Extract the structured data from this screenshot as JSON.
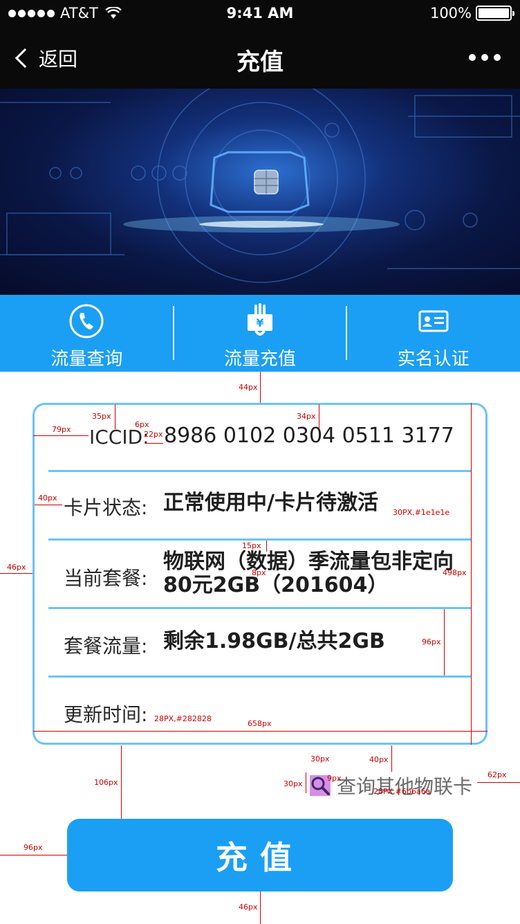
{
  "status_bar": {
    "carrier": "AT&T",
    "time": "9:41 AM",
    "battery": "100%"
  },
  "nav": {
    "back_label": "返回",
    "title": "充值"
  },
  "actions": [
    {
      "label": "流量查询",
      "icon": "phone-icon"
    },
    {
      "label": "流量充值",
      "icon": "yuan-card-icon"
    },
    {
      "label": "实名认证",
      "icon": "id-card-icon"
    }
  ],
  "card": {
    "iccid_label": "ICCID:",
    "iccid_value": "8986 0102 0304 0511 3177",
    "rows": [
      {
        "label": "卡片状态:",
        "value": "正常使用中/卡片待激活"
      },
      {
        "label": "当前套餐:",
        "value_line1": "物联网（数据）季流量包非定向",
        "value_line2": "80元2GB（201604）"
      },
      {
        "label": "套餐流量:",
        "value": "剩余1.98GB/总共2GB"
      },
      {
        "label": "更新时间:",
        "value": ""
      }
    ]
  },
  "query_other": {
    "label": "查询其他物联卡",
    "icon": "search-icon"
  },
  "charge_button": {
    "label": "充值"
  },
  "annotations": {
    "a44top": "44px",
    "a35": "35px",
    "a6": "6px",
    "a34": "34px",
    "a79": "79px",
    "a22": "22px",
    "a40": "40px",
    "a30c": "30PX,#1e1e1e",
    "a15": "15px",
    "a8": "8px",
    "a46l": "46px",
    "a498": "498px",
    "a96r": "96px",
    "a28c": "28PX,#282828",
    "a658": "658px",
    "a30w": "30px",
    "a40b": "40px",
    "a106": "106px",
    "a30h": "30px",
    "a9": "9px",
    "a62": "62px",
    "a28q": "28PX,#6b6a6a",
    "a96l": "96px",
    "a46b": "46px"
  },
  "colors": {
    "accent": "#1b9ff4",
    "card_border": "#6cc3f5",
    "value_text": "#1e1e1e",
    "label_text": "#282828",
    "query_text": "#6b6a6a"
  }
}
